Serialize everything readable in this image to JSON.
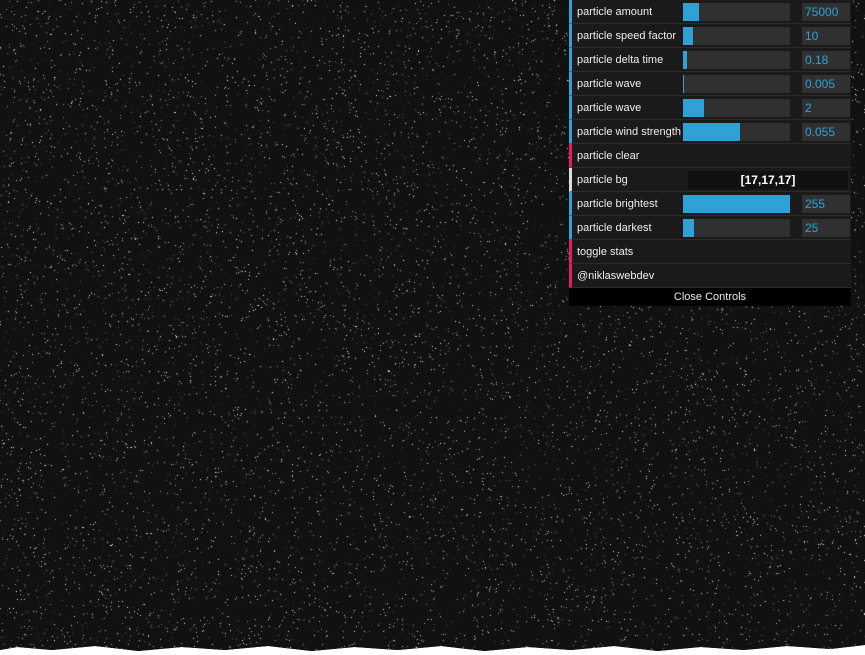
{
  "controls": {
    "sliders": [
      {
        "label": "particle amount",
        "value": "75000",
        "fill": 0.15
      },
      {
        "label": "particle speed factor",
        "value": "10",
        "fill": 0.09
      },
      {
        "label": "particle delta time",
        "value": "0.18",
        "fill": 0.04
      },
      {
        "label": "particle wave",
        "value": "0.005",
        "fill": 0.01
      },
      {
        "label": "particle wave",
        "value": "2",
        "fill": 0.2
      },
      {
        "label": "particle wind strength",
        "value": "0.055",
        "fill": 0.53
      }
    ],
    "clear_label": "particle clear",
    "bg_label": "particle bg",
    "bg_value": "[17,17,17]",
    "sliders2": [
      {
        "label": "particle brightest",
        "value": "255",
        "fill": 1.0
      },
      {
        "label": "particle darkest",
        "value": "25",
        "fill": 0.1
      }
    ],
    "toggle_stats_label": "toggle stats",
    "credit_label": "@niklaswebdev",
    "close_label": "Close Controls"
  },
  "colors": {
    "background": "#111111",
    "accent_number": "#2fa1d6",
    "accent_function": "#e61d5f"
  }
}
